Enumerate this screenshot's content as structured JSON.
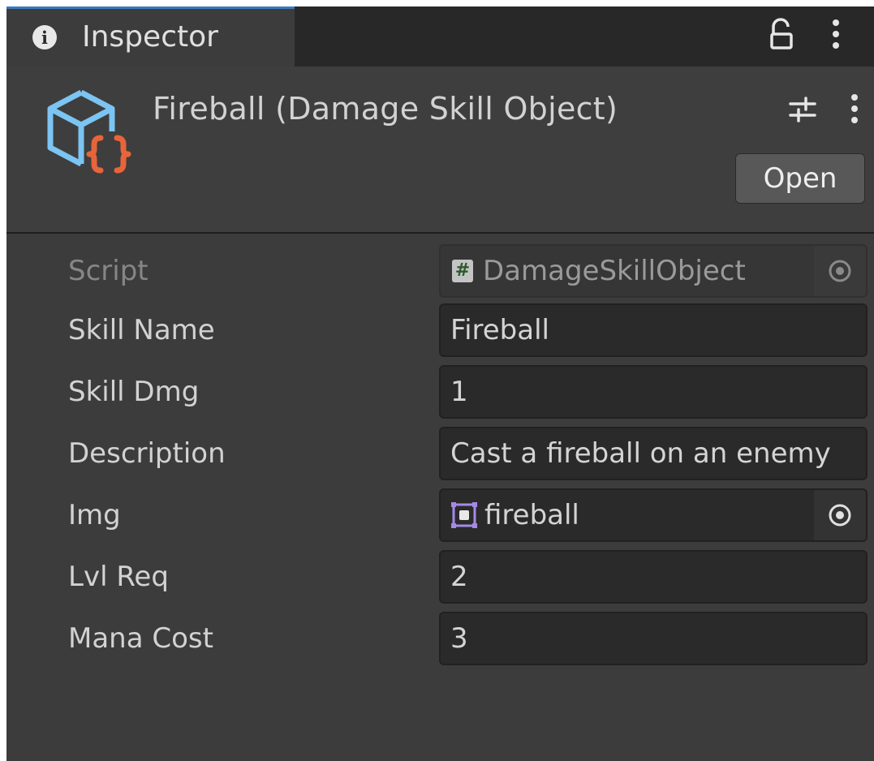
{
  "tab": {
    "title": "Inspector",
    "info_icon": "info-icon",
    "lock_icon": "lock-icon",
    "more_icon": "vertical-ellipsis-icon",
    "accent_color": "#3a79bb"
  },
  "header": {
    "asset_icon": "scriptable-object-icon",
    "title": "Fireball (Damage Skill Object)",
    "settings_icon": "settings-sliders-icon",
    "more_icon": "vertical-ellipsis-icon",
    "open_label": "Open"
  },
  "properties": {
    "script": {
      "label": "Script",
      "value": "DamageSkillObject",
      "glyph": "#"
    },
    "skill_name": {
      "label": "Skill Name",
      "value": "Fireball"
    },
    "skill_dmg": {
      "label": "Skill Dmg",
      "value": "1"
    },
    "description": {
      "label": "Description",
      "value": "Cast a fireball on an enemy"
    },
    "img": {
      "label": "Img",
      "value": "fireball",
      "icon": "sprite-icon"
    },
    "lvl_req": {
      "label": "Lvl Req",
      "value": "2"
    },
    "mana_cost": {
      "label": "Mana Cost",
      "value": "3"
    }
  }
}
